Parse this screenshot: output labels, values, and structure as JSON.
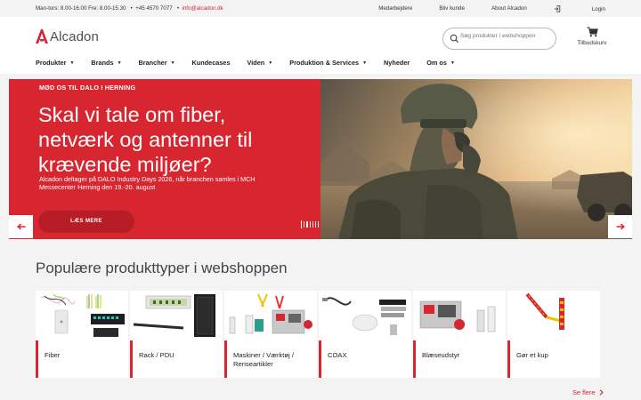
{
  "utility": {
    "hours": "Man-tors: 8.00-16.00 Fre: 8.00-15.30",
    "phone": "+45 4570 7077",
    "email": "info@alcadon.dk",
    "links": [
      "Medarbejdere",
      "Bliv kunde",
      "About Alcadon"
    ],
    "login": "Login"
  },
  "header": {
    "logo": "Alcadon",
    "search_placeholder": "Søg produkter i webshoppen",
    "cart_label": "Tilbudskurv"
  },
  "nav": [
    {
      "label": "Produkter",
      "dropdown": true
    },
    {
      "label": "Brands",
      "dropdown": true
    },
    {
      "label": "Brancher",
      "dropdown": true
    },
    {
      "label": "Kundecases",
      "dropdown": false
    },
    {
      "label": "Viden",
      "dropdown": true
    },
    {
      "label": "Produktion & Services",
      "dropdown": true
    },
    {
      "label": "Nyheder",
      "dropdown": false
    },
    {
      "label": "Om os",
      "dropdown": true
    }
  ],
  "hero": {
    "eyebrow": "MØD OS TIL DALO I HERNING",
    "headline": "Skal vi tale om fiber, netværk og antenner til krævende miljøer?",
    "body": "Alcadon deltager på DALO Industry Days 2026, når branchen samles i MCH Messecenter Herning den 19.-20. august",
    "cta": "LÆS MERE",
    "slide_count": 12,
    "active_slide": 0
  },
  "section": {
    "title": "Populære produkttyper i webshoppen",
    "more": "Se flere"
  },
  "cards": [
    {
      "label": "Fiber",
      "icon": "fiber-products-image"
    },
    {
      "label": "Rack / PDU",
      "icon": "rack-pdu-image"
    },
    {
      "label": "Maskiner / Værktøj / Renseartikler",
      "icon": "tools-image"
    },
    {
      "label": "COAX",
      "icon": "coax-image"
    },
    {
      "label": "Blæseudstyr",
      "icon": "blowing-equipment-image"
    },
    {
      "label": "Gør et kup",
      "icon": "deal-image"
    }
  ],
  "colors": {
    "brand_red": "#d7262f",
    "cta_red": "#b71d26",
    "background": "#f3f3f4"
  }
}
